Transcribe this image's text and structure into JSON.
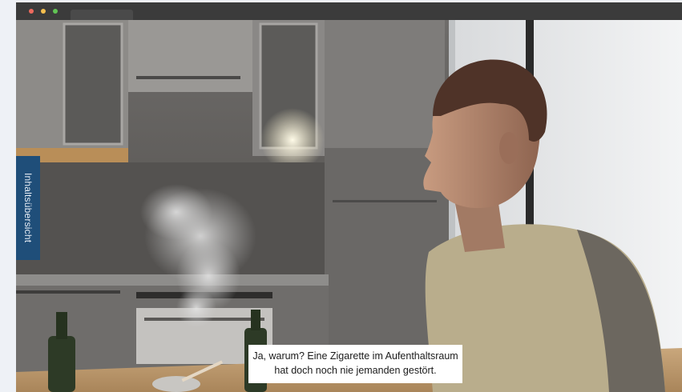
{
  "window": {
    "traffic_lights": [
      "red",
      "yellow",
      "green"
    ],
    "colors": {
      "red": "#ed6a5e",
      "yellow": "#f5bf4f",
      "green": "#61c454"
    }
  },
  "sidebar": {
    "toc_tab_label": "Inhaltsübersicht",
    "toc_tab_color": "#1f4e79"
  },
  "scene": {
    "subtitle_lines": [
      "Ja, warum? Eine Zigarette im Aufenthaltsraum",
      "hat doch noch nie jemanden gestört."
    ]
  }
}
